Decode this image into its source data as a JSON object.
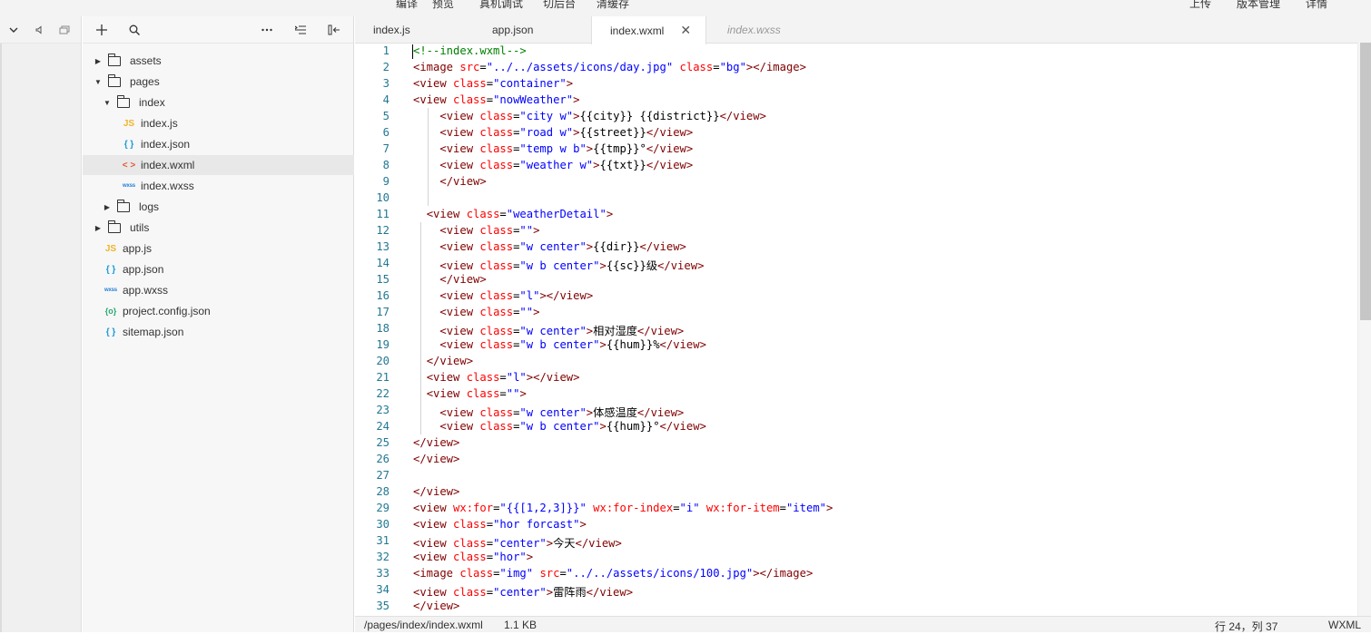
{
  "topbar": {
    "menu": [
      "编译",
      "预览",
      "真机调试",
      "切后台",
      "清缓存"
    ],
    "right_menu": [
      "上传",
      "版本管理",
      "详情"
    ]
  },
  "left_strip_icons": [
    "chevron-down-icon",
    "speaker-icon",
    "window-icon"
  ],
  "explorer": {
    "tools": [
      "plus-icon",
      "search-icon",
      "more-icon",
      "outline-icon",
      "collapse-icon"
    ],
    "tree": [
      {
        "label": "assets",
        "type": "folder",
        "depth": 0,
        "open": false
      },
      {
        "label": "pages",
        "type": "folder",
        "depth": 0,
        "open": true
      },
      {
        "label": "index",
        "type": "folder",
        "depth": 1,
        "open": true
      },
      {
        "label": "index.js",
        "type": "js",
        "depth": 2
      },
      {
        "label": "index.json",
        "type": "json",
        "depth": 2
      },
      {
        "label": "index.wxml",
        "type": "wxml",
        "depth": 2,
        "selected": true
      },
      {
        "label": "index.wxss",
        "type": "wxss",
        "depth": 2
      },
      {
        "label": "logs",
        "type": "folder",
        "depth": 1,
        "open": false
      },
      {
        "label": "utils",
        "type": "folder",
        "depth": 0,
        "open": false
      },
      {
        "label": "app.js",
        "type": "js",
        "depth": 0
      },
      {
        "label": "app.json",
        "type": "json",
        "depth": 0
      },
      {
        "label": "app.wxss",
        "type": "wxss",
        "depth": 0
      },
      {
        "label": "project.config.json",
        "type": "cfg",
        "depth": 0
      },
      {
        "label": "sitemap.json",
        "type": "json",
        "depth": 0
      }
    ],
    "icon_glyphs": {
      "js": "JS",
      "json": "{ }",
      "wxml": "< >",
      "wxss": "wxss",
      "cfg": "{o}"
    }
  },
  "tabs": [
    {
      "label": "index.js",
      "active": false,
      "preview": false
    },
    {
      "label": "app.json",
      "active": false,
      "preview": false
    },
    {
      "label": "index.wxml",
      "active": true,
      "preview": false
    },
    {
      "label": "index.wxss",
      "active": false,
      "preview": true
    }
  ],
  "editor": {
    "lines": [
      "<!--index.wxml-->",
      "<image src=\"../../assets/icons/day.jpg\" class=\"bg\"></image>",
      "<view class=\"container\">",
      "<view class=\"nowWeather\">",
      "    <view class=\"city w\">{{city}} {{district}}</view>",
      "    <view class=\"road w\">{{street}}</view>",
      "    <view class=\"temp w b\">{{tmp}}°</view>",
      "    <view class=\"weather w\">{{txt}}</view>",
      "    </view>",
      "",
      "  <view class=\"weatherDetail\">",
      "    <view class=\"\">",
      "    <view class=\"w center\">{{dir}}</view>",
      "    <view class=\"w b center\">{{sc}}级</view>",
      "    </view>",
      "    <view class=\"l\"></view>",
      "    <view class=\"\">",
      "    <view class=\"w center\">相对湿度</view>",
      "    <view class=\"w b center\">{{hum}}%</view>",
      "  </view>",
      "  <view class=\"l\"></view>",
      "  <view class=\"\">",
      "    <view class=\"w center\">体感温度</view>",
      "    <view class=\"w b center\">{{hum}}°</view>",
      "</view>",
      "</view>",
      "",
      "</view>",
      "<view wx:for=\"{{[1,2,3]}}\" wx:for-index=\"i\" wx:for-item=\"item\">",
      "<view class=\"hor forcast\">",
      "<view class=\"center\">今天</view>",
      "<view class=\"hor\">",
      "<image class=\"img\" src=\"../../assets/icons/100.jpg\"></image>",
      "<view class=\"center\">雷阵雨</view>",
      "</view>"
    ]
  },
  "status": {
    "path": "/pages/index/index.wxml",
    "size": "1.1 KB",
    "position": "行 24，列 37",
    "language": "WXML"
  }
}
